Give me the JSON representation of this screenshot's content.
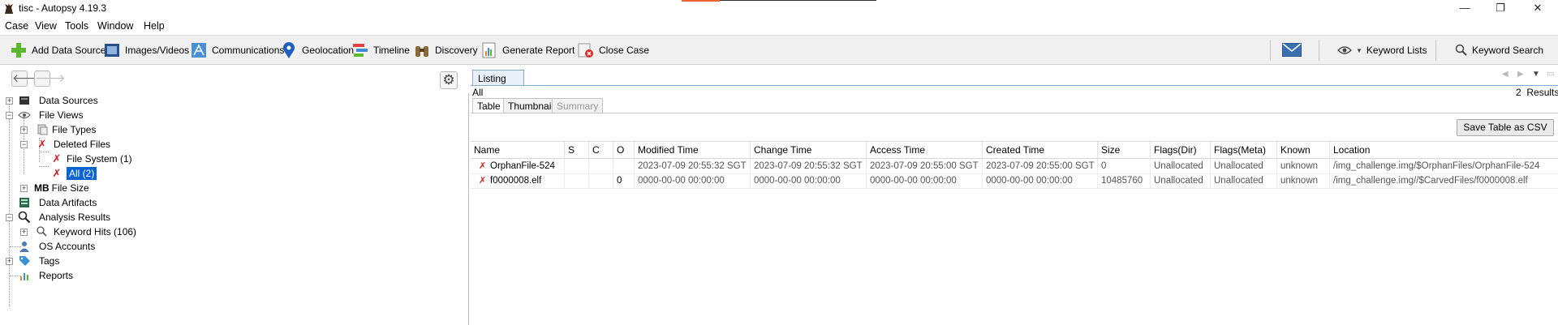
{
  "window": {
    "title": "tisc - Autopsy 4.19.3",
    "controls": {
      "minimize": "—",
      "restore": "❐",
      "close": "✕"
    }
  },
  "menu": [
    "Case",
    "View",
    "Tools",
    "Window",
    "Help"
  ],
  "toolbar": {
    "items": [
      {
        "label": "Add Data Source",
        "icon": "add-plus-icon"
      },
      {
        "label": "Images/Videos",
        "icon": "film-icon"
      },
      {
        "label": "Communications",
        "icon": "communications-icon"
      },
      {
        "label": "Geolocation",
        "icon": "map-pin-icon"
      },
      {
        "label": "Timeline",
        "icon": "timeline-icon"
      },
      {
        "label": "Discovery",
        "icon": "binoculars-icon"
      },
      {
        "label": "Generate Report",
        "icon": "report-icon"
      },
      {
        "label": "Close Case",
        "icon": "close-case-icon"
      }
    ],
    "right": {
      "keyword_lists": "Keyword Lists",
      "keyword_search": "Keyword Search"
    }
  },
  "tree": {
    "items": [
      {
        "label": "Data Sources"
      },
      {
        "label": "File Views"
      },
      {
        "label": "File Types"
      },
      {
        "label": "Deleted Files"
      },
      {
        "label": "File System (1)"
      },
      {
        "label": "All (2)"
      },
      {
        "label": "File Size",
        "prefix": "MB"
      },
      {
        "label": "Data Artifacts"
      },
      {
        "label": "Analysis Results"
      },
      {
        "label": "Keyword Hits (106)"
      },
      {
        "label": "OS Accounts"
      },
      {
        "label": "Tags"
      },
      {
        "label": "Reports"
      }
    ]
  },
  "listing": {
    "tab": "Listing",
    "breadcrumb": "All",
    "results_count": "2",
    "results_label": "Results",
    "subtabs": [
      "Table",
      "Thumbnail",
      "Summary"
    ],
    "save_csv": "Save Table as CSV"
  },
  "table": {
    "columns": [
      "Name",
      "S",
      "C",
      "O",
      "Modified Time",
      "Change Time",
      "Access Time",
      "Created Time",
      "Size",
      "Flags(Dir)",
      "Flags(Meta)",
      "Known",
      "Location"
    ],
    "rows": [
      {
        "name": "OrphanFile-524",
        "s": "",
        "c": "",
        "o": "",
        "modified": "2023-07-09 20:55:32 SGT",
        "change": "2023-07-09 20:55:32 SGT",
        "access": "2023-07-09 20:55:00 SGT",
        "created": "2023-07-09 20:55:00 SGT",
        "size": "0",
        "flags_dir": "Unallocated",
        "flags_meta": "Unallocated",
        "known": "unknown",
        "location": "/img_challenge.img/$OrphanFiles/OrphanFile-524"
      },
      {
        "name": "f0000008.elf",
        "s": "",
        "c": "",
        "o": "0",
        "modified": "0000-00-00 00:00:00",
        "change": "0000-00-00 00:00:00",
        "access": "0000-00-00 00:00:00",
        "created": "0000-00-00 00:00:00",
        "size": "10485760",
        "flags_dir": "Unallocated",
        "flags_meta": "Unallocated",
        "known": "unknown",
        "location": "/img_challenge.img//$CarvedFiles/f0000008.elf"
      }
    ]
  }
}
